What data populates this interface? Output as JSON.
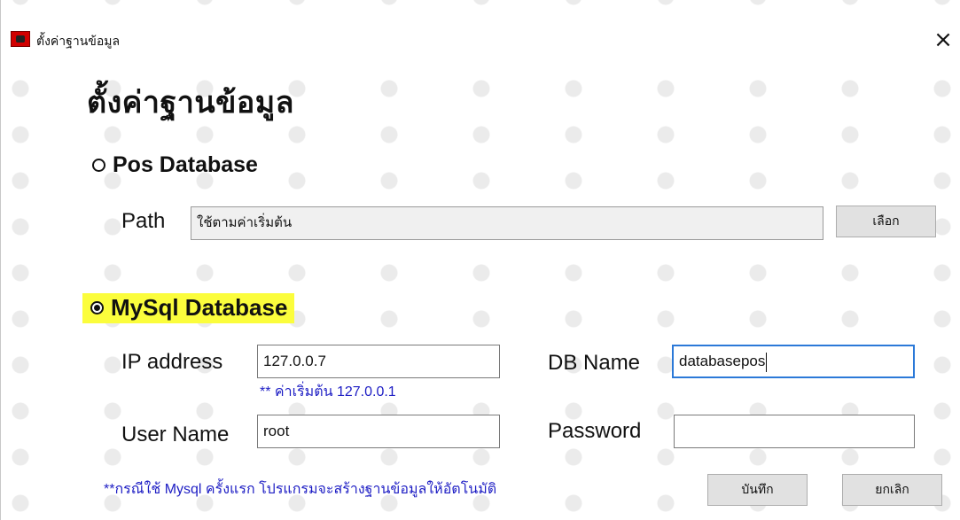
{
  "window": {
    "title": "ตั้งค่าฐานข้อมูล",
    "close_symbol": "×"
  },
  "heading": "ตั้งค่าฐานข้อมูล",
  "pos_database": {
    "radio_label": "Pos Database",
    "selected": false,
    "path_label": "Path",
    "path_value": "ใช้ตามค่าเริ่มต้น",
    "browse_button": "เลือก"
  },
  "mysql_database": {
    "radio_label": "MySql Database",
    "selected": true,
    "highlight_color": "#fbfd3c",
    "ip_label": "IP address",
    "ip_value": "127.0.0.7",
    "ip_hint": "** ค่าเริ่มต้น 127.0.0.1",
    "db_name_label": "DB Name",
    "db_name_value": "databasepos",
    "username_label": "User Name",
    "username_value": "root",
    "password_label": "Password",
    "password_value": ""
  },
  "footer": {
    "note": "**กรณีใช้ Mysql ครั้งแรก  โปรแกรมจะสร้างฐานข้อมูลให้อัตโนมัติ",
    "save_button": "บันทึก",
    "cancel_button": "ยกเลิก"
  },
  "colors": {
    "hint_text": "#1d1dc4",
    "focus_border": "#2b79d8",
    "app_icon": "#d10000"
  }
}
